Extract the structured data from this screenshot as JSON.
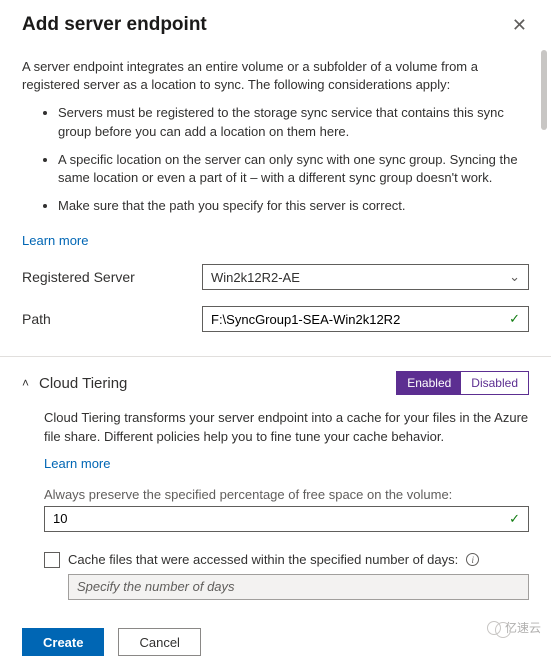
{
  "header": {
    "title": "Add server endpoint"
  },
  "intro": "A server endpoint integrates an entire volume or a subfolder of a volume from a registered server as a location to sync. The following considerations apply:",
  "bullets": [
    "Servers must be registered to the storage sync service that contains this sync group before you can add a location on them here.",
    "A specific location on the server can only sync with one sync group. Syncing the same location or even a part of it – with a different sync group doesn't work.",
    "Make sure that the path you specify for this server is correct."
  ],
  "learn_more": "Learn more",
  "fields": {
    "registered_server": {
      "label": "Registered Server",
      "value": "Win2k12R2-AE"
    },
    "path": {
      "label": "Path",
      "value": "F:\\SyncGroup1-SEA-Win2k12R2"
    }
  },
  "tiering": {
    "title": "Cloud Tiering",
    "enabled_label": "Enabled",
    "disabled_label": "Disabled",
    "description": "Cloud Tiering transforms your server endpoint into a cache for your files in the Azure file share. Different policies help you to fine tune your cache behavior.",
    "learn_more": "Learn more",
    "free_space_label": "Always preserve the specified percentage of free space on the volume:",
    "free_space_value": "10",
    "days_checkbox_label": "Cache files that were accessed within the specified number of days:",
    "days_placeholder": "Specify the number of days"
  },
  "footer": {
    "create": "Create",
    "cancel": "Cancel"
  },
  "watermark": "亿速云"
}
